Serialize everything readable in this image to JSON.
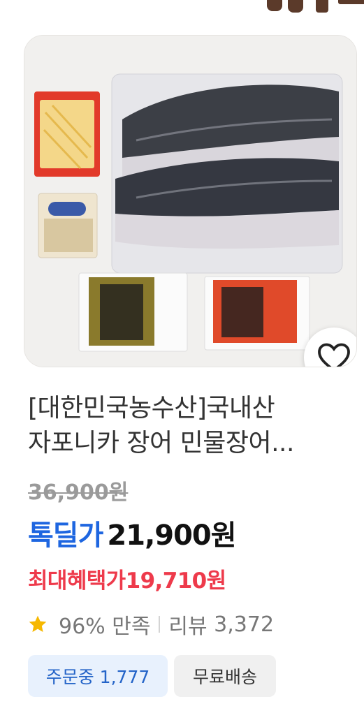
{
  "product": {
    "title_line1": "[대한민국농수산]국내산",
    "title_line2": "자포니카 장어 민물장어...",
    "original_price": "36,900원",
    "deal_label": "톡딜가",
    "deal_price": "21,900원",
    "max_benefit_label": "최대혜택가",
    "max_benefit_price": "19,710원",
    "satisfaction": "96% 만족",
    "review_label": "리뷰",
    "review_count": "3,372",
    "order_badge": "주문중 1,777",
    "shipping_badge": "무료배송"
  },
  "icons": {
    "wish": "heart-outline-icon",
    "rating": "star-icon"
  },
  "colors": {
    "deal_blue": "#1e66e0",
    "max_red": "#ee3a4b",
    "star_yellow": "#f6b800",
    "order_badge_bg": "#e8f1fd",
    "order_badge_text": "#2464c8"
  }
}
